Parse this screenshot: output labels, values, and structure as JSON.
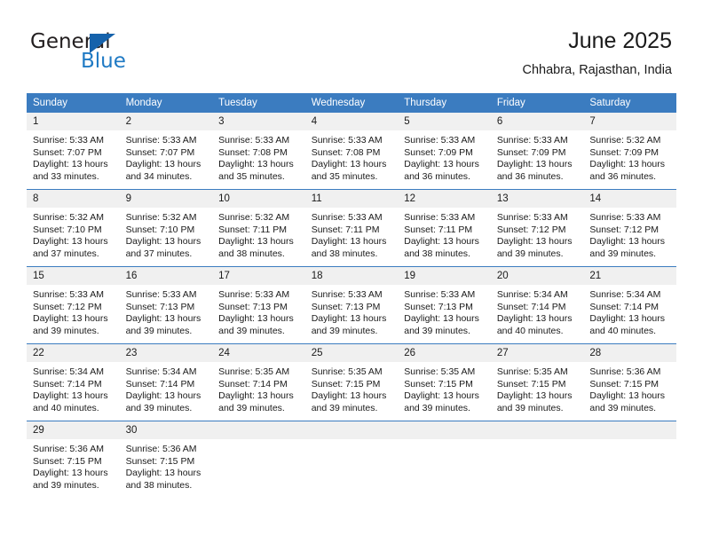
{
  "brand": {
    "name_part1": "General",
    "name_part2": "Blue",
    "triangle_icon": "triangle-icon",
    "accent_color": "#1f7ac4"
  },
  "header": {
    "title": "June 2025",
    "subtitle": "Chhabra, Rajasthan, India"
  },
  "theme": {
    "header_blue": "#3b7cc0",
    "daynum_band": "#f0f0f0",
    "text": "#1a1a1a"
  },
  "calendar": {
    "weekday_headers": [
      "Sunday",
      "Monday",
      "Tuesday",
      "Wednesday",
      "Thursday",
      "Friday",
      "Saturday"
    ],
    "weeks": [
      [
        {
          "day": "1",
          "sunrise": "Sunrise: 5:33 AM",
          "sunset": "Sunset: 7:07 PM",
          "daylight_line1": "Daylight: 13 hours",
          "daylight_line2": "and 33 minutes."
        },
        {
          "day": "2",
          "sunrise": "Sunrise: 5:33 AM",
          "sunset": "Sunset: 7:07 PM",
          "daylight_line1": "Daylight: 13 hours",
          "daylight_line2": "and 34 minutes."
        },
        {
          "day": "3",
          "sunrise": "Sunrise: 5:33 AM",
          "sunset": "Sunset: 7:08 PM",
          "daylight_line1": "Daylight: 13 hours",
          "daylight_line2": "and 35 minutes."
        },
        {
          "day": "4",
          "sunrise": "Sunrise: 5:33 AM",
          "sunset": "Sunset: 7:08 PM",
          "daylight_line1": "Daylight: 13 hours",
          "daylight_line2": "and 35 minutes."
        },
        {
          "day": "5",
          "sunrise": "Sunrise: 5:33 AM",
          "sunset": "Sunset: 7:09 PM",
          "daylight_line1": "Daylight: 13 hours",
          "daylight_line2": "and 36 minutes."
        },
        {
          "day": "6",
          "sunrise": "Sunrise: 5:33 AM",
          "sunset": "Sunset: 7:09 PM",
          "daylight_line1": "Daylight: 13 hours",
          "daylight_line2": "and 36 minutes."
        },
        {
          "day": "7",
          "sunrise": "Sunrise: 5:32 AM",
          "sunset": "Sunset: 7:09 PM",
          "daylight_line1": "Daylight: 13 hours",
          "daylight_line2": "and 36 minutes."
        }
      ],
      [
        {
          "day": "8",
          "sunrise": "Sunrise: 5:32 AM",
          "sunset": "Sunset: 7:10 PM",
          "daylight_line1": "Daylight: 13 hours",
          "daylight_line2": "and 37 minutes."
        },
        {
          "day": "9",
          "sunrise": "Sunrise: 5:32 AM",
          "sunset": "Sunset: 7:10 PM",
          "daylight_line1": "Daylight: 13 hours",
          "daylight_line2": "and 37 minutes."
        },
        {
          "day": "10",
          "sunrise": "Sunrise: 5:32 AM",
          "sunset": "Sunset: 7:11 PM",
          "daylight_line1": "Daylight: 13 hours",
          "daylight_line2": "and 38 minutes."
        },
        {
          "day": "11",
          "sunrise": "Sunrise: 5:33 AM",
          "sunset": "Sunset: 7:11 PM",
          "daylight_line1": "Daylight: 13 hours",
          "daylight_line2": "and 38 minutes."
        },
        {
          "day": "12",
          "sunrise": "Sunrise: 5:33 AM",
          "sunset": "Sunset: 7:11 PM",
          "daylight_line1": "Daylight: 13 hours",
          "daylight_line2": "and 38 minutes."
        },
        {
          "day": "13",
          "sunrise": "Sunrise: 5:33 AM",
          "sunset": "Sunset: 7:12 PM",
          "daylight_line1": "Daylight: 13 hours",
          "daylight_line2": "and 39 minutes."
        },
        {
          "day": "14",
          "sunrise": "Sunrise: 5:33 AM",
          "sunset": "Sunset: 7:12 PM",
          "daylight_line1": "Daylight: 13 hours",
          "daylight_line2": "and 39 minutes."
        }
      ],
      [
        {
          "day": "15",
          "sunrise": "Sunrise: 5:33 AM",
          "sunset": "Sunset: 7:12 PM",
          "daylight_line1": "Daylight: 13 hours",
          "daylight_line2": "and 39 minutes."
        },
        {
          "day": "16",
          "sunrise": "Sunrise: 5:33 AM",
          "sunset": "Sunset: 7:13 PM",
          "daylight_line1": "Daylight: 13 hours",
          "daylight_line2": "and 39 minutes."
        },
        {
          "day": "17",
          "sunrise": "Sunrise: 5:33 AM",
          "sunset": "Sunset: 7:13 PM",
          "daylight_line1": "Daylight: 13 hours",
          "daylight_line2": "and 39 minutes."
        },
        {
          "day": "18",
          "sunrise": "Sunrise: 5:33 AM",
          "sunset": "Sunset: 7:13 PM",
          "daylight_line1": "Daylight: 13 hours",
          "daylight_line2": "and 39 minutes."
        },
        {
          "day": "19",
          "sunrise": "Sunrise: 5:33 AM",
          "sunset": "Sunset: 7:13 PM",
          "daylight_line1": "Daylight: 13 hours",
          "daylight_line2": "and 39 minutes."
        },
        {
          "day": "20",
          "sunrise": "Sunrise: 5:34 AM",
          "sunset": "Sunset: 7:14 PM",
          "daylight_line1": "Daylight: 13 hours",
          "daylight_line2": "and 40 minutes."
        },
        {
          "day": "21",
          "sunrise": "Sunrise: 5:34 AM",
          "sunset": "Sunset: 7:14 PM",
          "daylight_line1": "Daylight: 13 hours",
          "daylight_line2": "and 40 minutes."
        }
      ],
      [
        {
          "day": "22",
          "sunrise": "Sunrise: 5:34 AM",
          "sunset": "Sunset: 7:14 PM",
          "daylight_line1": "Daylight: 13 hours",
          "daylight_line2": "and 40 minutes."
        },
        {
          "day": "23",
          "sunrise": "Sunrise: 5:34 AM",
          "sunset": "Sunset: 7:14 PM",
          "daylight_line1": "Daylight: 13 hours",
          "daylight_line2": "and 39 minutes."
        },
        {
          "day": "24",
          "sunrise": "Sunrise: 5:35 AM",
          "sunset": "Sunset: 7:14 PM",
          "daylight_line1": "Daylight: 13 hours",
          "daylight_line2": "and 39 minutes."
        },
        {
          "day": "25",
          "sunrise": "Sunrise: 5:35 AM",
          "sunset": "Sunset: 7:15 PM",
          "daylight_line1": "Daylight: 13 hours",
          "daylight_line2": "and 39 minutes."
        },
        {
          "day": "26",
          "sunrise": "Sunrise: 5:35 AM",
          "sunset": "Sunset: 7:15 PM",
          "daylight_line1": "Daylight: 13 hours",
          "daylight_line2": "and 39 minutes."
        },
        {
          "day": "27",
          "sunrise": "Sunrise: 5:35 AM",
          "sunset": "Sunset: 7:15 PM",
          "daylight_line1": "Daylight: 13 hours",
          "daylight_line2": "and 39 minutes."
        },
        {
          "day": "28",
          "sunrise": "Sunrise: 5:36 AM",
          "sunset": "Sunset: 7:15 PM",
          "daylight_line1": "Daylight: 13 hours",
          "daylight_line2": "and 39 minutes."
        }
      ],
      [
        {
          "day": "29",
          "sunrise": "Sunrise: 5:36 AM",
          "sunset": "Sunset: 7:15 PM",
          "daylight_line1": "Daylight: 13 hours",
          "daylight_line2": "and 39 minutes."
        },
        {
          "day": "30",
          "sunrise": "Sunrise: 5:36 AM",
          "sunset": "Sunset: 7:15 PM",
          "daylight_line1": "Daylight: 13 hours",
          "daylight_line2": "and 38 minutes."
        },
        {
          "day": "",
          "sunrise": "",
          "sunset": "",
          "daylight_line1": "",
          "daylight_line2": ""
        },
        {
          "day": "",
          "sunrise": "",
          "sunset": "",
          "daylight_line1": "",
          "daylight_line2": ""
        },
        {
          "day": "",
          "sunrise": "",
          "sunset": "",
          "daylight_line1": "",
          "daylight_line2": ""
        },
        {
          "day": "",
          "sunrise": "",
          "sunset": "",
          "daylight_line1": "",
          "daylight_line2": ""
        },
        {
          "day": "",
          "sunrise": "",
          "sunset": "",
          "daylight_line1": "",
          "daylight_line2": ""
        }
      ]
    ]
  }
}
